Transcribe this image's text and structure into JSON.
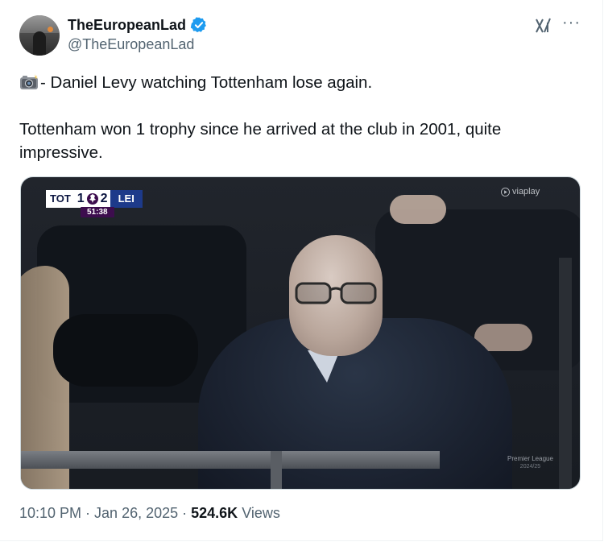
{
  "author": {
    "display_name": "TheEuropeanLad",
    "handle": "@TheEuropeanLad",
    "verified_color": "#1d9bf0"
  },
  "actions": {
    "grok_icon": "grok-icon",
    "more_icon": "more-dots-icon",
    "more_label": "···"
  },
  "tweet": {
    "line1": "- Daniel Levy watching Tottenham lose again.",
    "line2": "Tottenham won 1 trophy since he arrived at the club in 2001, quite impressive."
  },
  "media": {
    "scorebug": {
      "home": "TOT",
      "home_score": "1",
      "away_score": "2",
      "away": "LEI",
      "clock": "51:38"
    },
    "broadcaster": "viaplay",
    "watermark": "Premier League",
    "season": "2024/25"
  },
  "footer": {
    "time": "10:10 PM",
    "sep1": " · ",
    "date": "Jan 26, 2025",
    "sep2": " · ",
    "views_count": "524.6K",
    "views_label": " Views"
  }
}
